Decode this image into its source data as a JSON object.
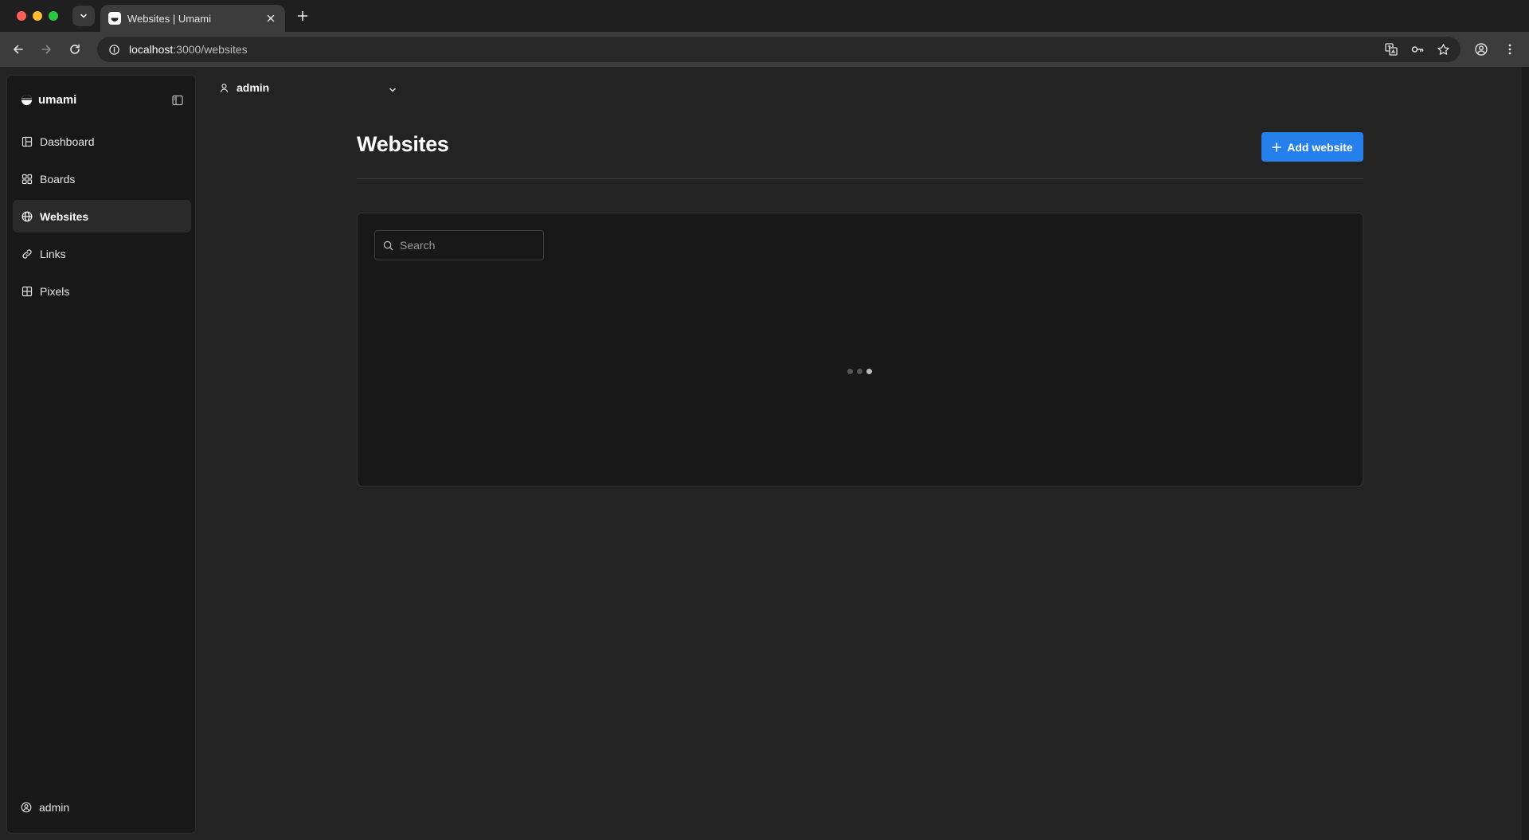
{
  "browser": {
    "tab_title": "Websites | Umami",
    "url_host": "localhost",
    "url_path": ":3000/websites"
  },
  "app": {
    "brand": "umami",
    "nav": [
      {
        "label": "Dashboard",
        "icon": "dashboard-icon",
        "active": false
      },
      {
        "label": "Boards",
        "icon": "boards-icon",
        "active": false
      },
      {
        "label": "Websites",
        "icon": "globe-icon",
        "active": true
      },
      {
        "label": "Links",
        "icon": "link-icon",
        "active": false
      },
      {
        "label": "Pixels",
        "icon": "grid-icon",
        "active": false
      }
    ],
    "sidebar_user": "admin",
    "topbar_user": "admin"
  },
  "main": {
    "title": "Websites",
    "add_button_label": "Add website",
    "search_placeholder": "Search"
  },
  "colors": {
    "accent": "#2680eb",
    "background": "#232323",
    "panel": "#181818"
  }
}
